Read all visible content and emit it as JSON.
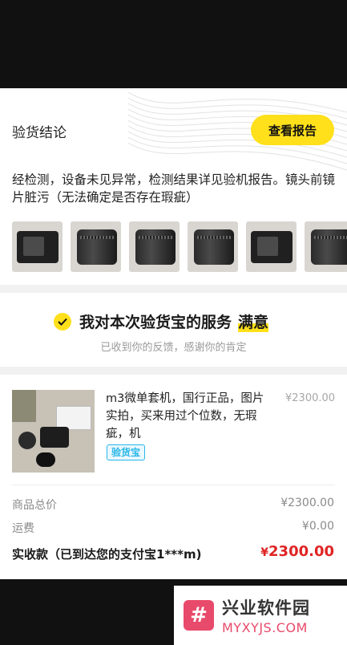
{
  "inspection": {
    "title": "验货结论",
    "report_button": "查看报告",
    "conclusion": "经检测，设备未见异常，检测结果详见验机报告。镜头前镜片脏污（无法确定是否存在瑕疵）",
    "thumbnails": [
      "camera-body-photo",
      "lens-photo",
      "lens-photo",
      "lens-photo",
      "camera-with-lens-photo",
      "lens-photo"
    ]
  },
  "satisfaction": {
    "text": "我对本次验货宝的服务",
    "highlight": "满意",
    "subtext": "已收到你的反馈，感谢你的肯定"
  },
  "order": {
    "product_title": "m3微单套机，国行正品，图片实拍，买来用过个位数，无瑕疵，机",
    "product_price": "¥2300.00",
    "badge": "验货宝",
    "rows": [
      {
        "label": "商品总价",
        "value": "¥2300.00"
      },
      {
        "label": "运费",
        "value": "¥0.00"
      }
    ],
    "total_label": "实收款（已到达您的支付宝1***m)",
    "total_currency": "¥",
    "total_value": "2300.00"
  },
  "watermark": {
    "logo": "#",
    "title": "兴业软件园",
    "subtitle": "MYXYJS.COM"
  },
  "colors": {
    "accent_yellow": "#ffe01b",
    "price_red": "#e02424",
    "badge_blue": "#28b6e8",
    "watermark_pink": "#e84a6b"
  }
}
